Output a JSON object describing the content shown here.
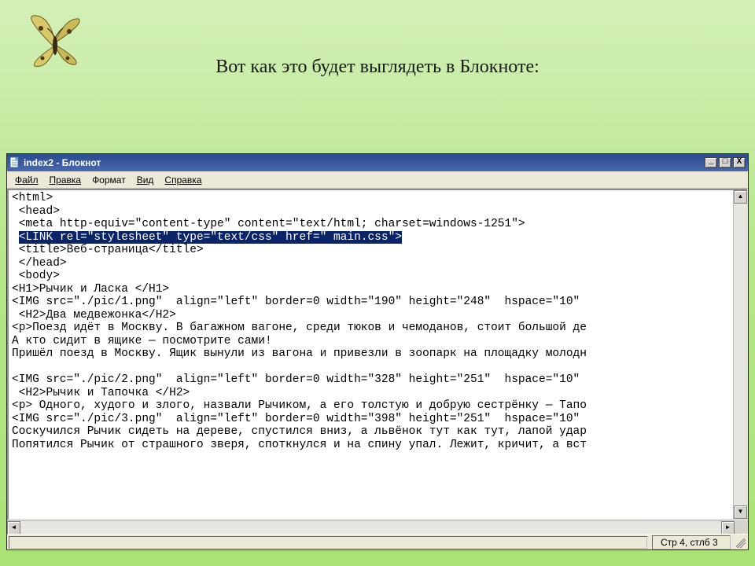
{
  "slide": {
    "caption": "Вот как это будет выглядеть в Блокноте:"
  },
  "window": {
    "title": "index2 - Блокнот",
    "controls": {
      "minimize": "_",
      "maximize": "□",
      "close": "X"
    }
  },
  "menu": {
    "file": "Файл",
    "edit": "Правка",
    "format": "Формат",
    "view": "Вид",
    "help": "Справка"
  },
  "editor": {
    "lines": [
      "<html>",
      " <head>",
      " <meta http-equiv=\"content-type\" content=\"text/html; charset=windows-1251\">",
      "",
      " <title>Веб-страница</title>",
      " </head>",
      " <body>",
      "<H1>Рычик и Ласка </H1>",
      "<IMG src=\"./pic/1.png\"  align=\"left\" border=0 width=\"190\" height=\"248\"  hspace=\"10\"",
      " <H2>Два медвежонка</H2>",
      "<р>Поезд идёт в Москву. В багажном вагоне, среди тюков и чемоданов, стоит большой де",
      "А кто сидит в ящике — посмотрите сами!",
      "Пришёл поезд в Москву. Ящик вынули из вагона и привезли в зоопарк на площадку молодн",
      "",
      "<IMG src=\"./pic/2.png\"  align=\"left\" border=0 width=\"328\" height=\"251\"  hspace=\"10\"",
      " <H2>Рычик и Тапочка </H2>",
      "<р> Одного, худого и злого, назвали Рычиком, а его толстую и добрую сестрёнку — Тапо",
      "<IMG src=\"./pic/3.png\"  align=\"left\" border=0 width=\"398\" height=\"251\"  hspace=\"10\"",
      "Соскучился Рычик сидеть на дереве, спустился вниз, а львёнок тут как тут, лапой удар",
      "Попятился Рычик от страшного зверя, споткнулся и на спину упал. Лежит, кричит, а вст"
    ],
    "selection_prefix": " ",
    "selection_text": "<LINK rel=\"stylesheet\" type=\"text/css\" href=\" main.css\">"
  },
  "statusbar": {
    "position": "Стр 4, стлб 3"
  }
}
